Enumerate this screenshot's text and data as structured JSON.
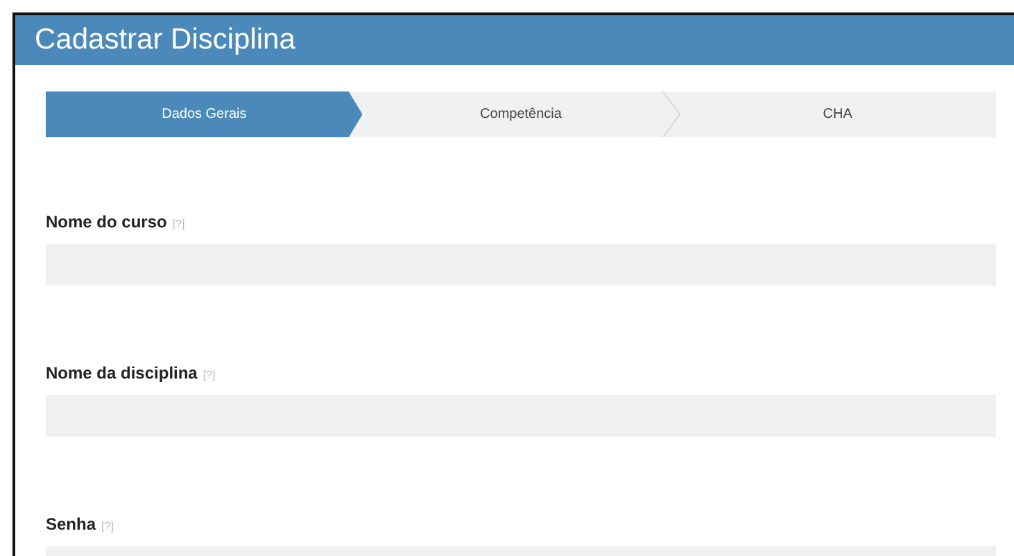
{
  "header": {
    "title": "Cadastrar Disciplina"
  },
  "steps": [
    {
      "label": "Dados Gerais",
      "selected": true
    },
    {
      "label": "Competência",
      "selected": false
    },
    {
      "label": "CHA",
      "selected": false
    }
  ],
  "fields": [
    {
      "label": "Nome do curso",
      "help": "[?]"
    },
    {
      "label": "Nome da disciplina",
      "help": "[?]"
    },
    {
      "label": "Senha",
      "help": "[?]"
    }
  ]
}
